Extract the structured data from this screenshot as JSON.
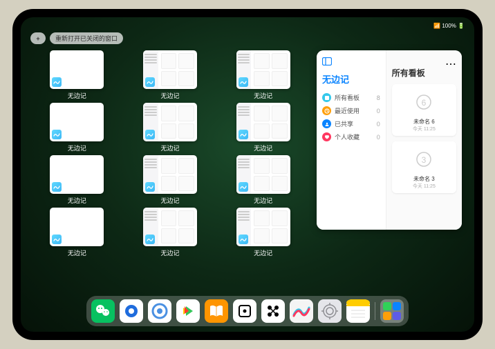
{
  "status": {
    "time": "",
    "indicators": "📶 100% 🔋"
  },
  "top": {
    "add": "+",
    "reopen": "重新打开已关闭的窗口"
  },
  "app_name": "无边记",
  "thumbnails": [
    {
      "label": "无边记",
      "type": "blank"
    },
    {
      "label": "无边记",
      "type": "detailed"
    },
    {
      "label": "无边记",
      "type": "detailed"
    },
    {
      "label": "无边记",
      "type": "blank"
    },
    {
      "label": "无边记",
      "type": "detailed"
    },
    {
      "label": "无边记",
      "type": "detailed"
    },
    {
      "label": "无边记",
      "type": "blank"
    },
    {
      "label": "无边记",
      "type": "detailed"
    },
    {
      "label": "无边记",
      "type": "detailed"
    },
    {
      "label": "无边记",
      "type": "blank"
    },
    {
      "label": "无边记",
      "type": "detailed"
    },
    {
      "label": "无边记",
      "type": "detailed"
    }
  ],
  "panel": {
    "title": "无边记",
    "items": [
      {
        "icon_color": "#34c8eb",
        "label": "所有看板",
        "count": "8"
      },
      {
        "icon_color": "#ff9f0a",
        "label": "最近使用",
        "count": "0"
      },
      {
        "icon_color": "#0a84ff",
        "label": "已共享",
        "count": "0"
      },
      {
        "icon_color": "#ff375f",
        "label": "个人收藏",
        "count": "0"
      }
    ],
    "main_title": "所有看板",
    "boards": [
      {
        "name": "未命名 6",
        "date": "今天 11:25",
        "digit": "6"
      },
      {
        "name": "未命名 3",
        "date": "今天 11:25",
        "digit": "3"
      }
    ]
  },
  "dock": {
    "items": [
      {
        "name": "wechat"
      },
      {
        "name": "qqbrowser"
      },
      {
        "name": "quark"
      },
      {
        "name": "video-app"
      },
      {
        "name": "books"
      },
      {
        "name": "dice-app"
      },
      {
        "name": "connect-app"
      },
      {
        "name": "freeform"
      },
      {
        "name": "settings"
      },
      {
        "name": "notes"
      }
    ],
    "recent": {
      "name": "app-library"
    }
  }
}
